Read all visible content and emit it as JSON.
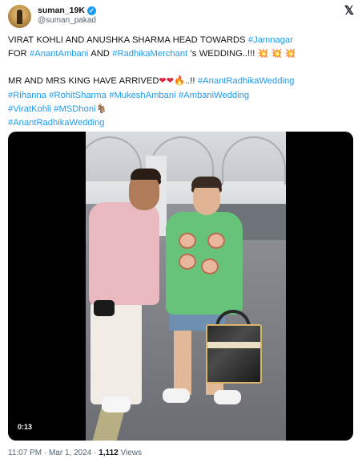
{
  "author": {
    "display_name": "suman_19K",
    "handle": "@suman_pakad",
    "verified_glyph": "✓"
  },
  "platform_logo": "𝕏",
  "tweet": {
    "line1_plain": "VIRAT KOHLI AND ANUSHKA SHARMA HEAD TOWARDS ",
    "line1_tag": "#Jamnagar",
    "line2_plain_a": "FOR ",
    "line2_tag_a": "#AnantAmbani",
    "line2_plain_b": " AND ",
    "line2_tag_b": "#RadhikaMerchant",
    "line2_plain_c": " 's WEDDING..!!! ",
    "line2_emoji": "💥 💥 💥",
    "line3_plain": "MR AND MRS KING HAVE ARRIVED",
    "line3_hearts": "❤❤",
    "line3_fire": "🔥",
    "line3_plain_b": "..!! ",
    "line3_tag": "#AnantRadhikaWedding",
    "line4_tags": "#Rihanna #RohitSharma #MukeshAmbani #AmbaniWedding",
    "line5_tags": "#ViratKohli #MSDhoni",
    "line5_emoji": "🐐",
    "line6_tags": "#AnantRadhikaWedding"
  },
  "video": {
    "elapsed": "0:13"
  },
  "footer": {
    "time": "11:07 PM",
    "separator": " · ",
    "date": "Mar 1, 2024",
    "views_count": "1,112",
    "views_label": " Views"
  },
  "icons": {
    "verified": "verified-badge-icon",
    "logo": "x-logo-icon"
  },
  "colors": {
    "link": "#1d9bf0",
    "text": "#0f1419",
    "muted": "#536471"
  }
}
